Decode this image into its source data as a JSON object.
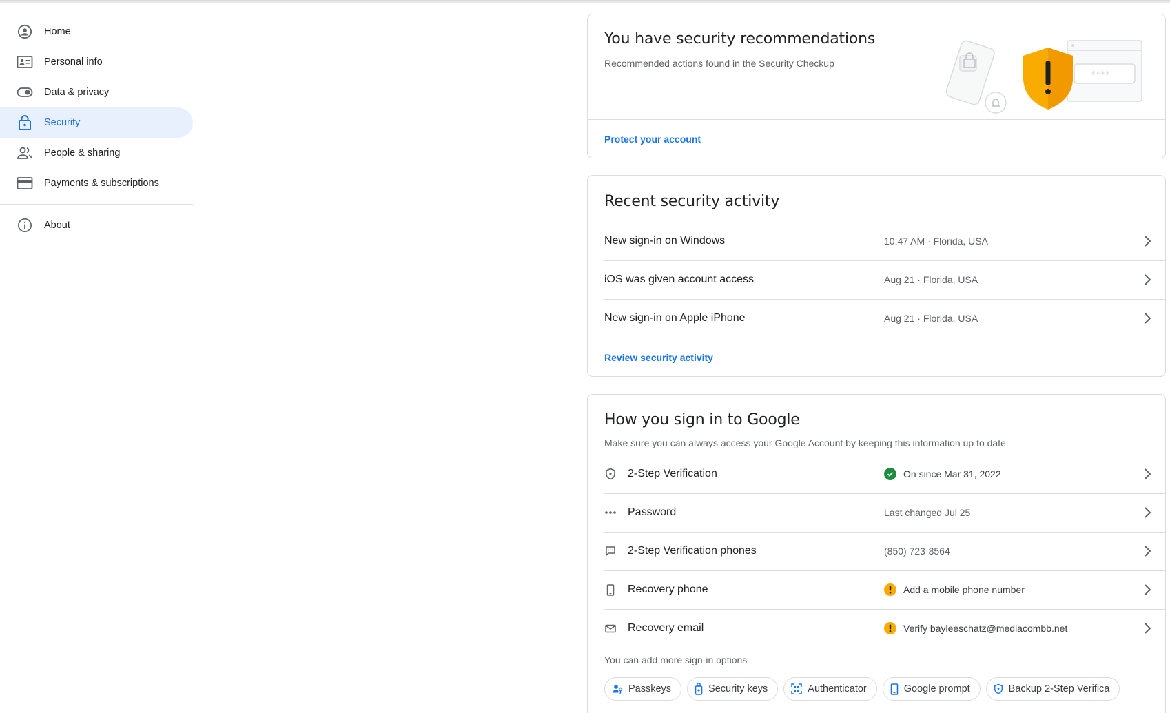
{
  "sidebar": {
    "items": [
      {
        "label": "Home",
        "icon": "account-circle-icon",
        "active": false
      },
      {
        "label": "Personal info",
        "icon": "id-card-icon",
        "active": false
      },
      {
        "label": "Data & privacy",
        "icon": "toggle-icon",
        "active": false
      },
      {
        "label": "Security",
        "icon": "lock-icon",
        "active": true
      },
      {
        "label": "People & sharing",
        "icon": "people-icon",
        "active": false
      },
      {
        "label": "Payments & subscriptions",
        "icon": "credit-card-icon",
        "active": false
      }
    ],
    "about": {
      "label": "About",
      "icon": "info-icon"
    }
  },
  "recommendations": {
    "title": "You have security recommendations",
    "subtitle": "Recommended actions found in the Security Checkup",
    "link": "Protect your account",
    "illustration_mask": "****"
  },
  "activity": {
    "title": "Recent security activity",
    "rows": [
      {
        "label": "New sign-in on Windows",
        "value": "10:47 AM · Florida, USA"
      },
      {
        "label": "iOS was given account access",
        "value": "Aug 21 · Florida, USA"
      },
      {
        "label": "New sign-in on Apple iPhone",
        "value": "Aug 21 · Florida, USA"
      }
    ],
    "link": "Review security activity"
  },
  "signin": {
    "title": "How you sign in to Google",
    "subtitle": "Make sure you can always access your Google Account by keeping this information up to date",
    "rows": [
      {
        "label": "2-Step Verification",
        "value": "On since Mar 31, 2022",
        "icon": "shield-icon",
        "status": "ok"
      },
      {
        "label": "Password",
        "value": "Last changed Jul 25",
        "icon": "password-dots-icon",
        "status": "none"
      },
      {
        "label": "2-Step Verification phones",
        "value": "(850) 723-8564",
        "icon": "message-icon",
        "status": "none"
      },
      {
        "label": "Recovery phone",
        "value": "Add a mobile phone number",
        "icon": "phone-icon",
        "status": "warn"
      },
      {
        "label": "Recovery email",
        "value": "Verify bayleeschatz@mediacombb.net",
        "icon": "mail-icon",
        "status": "warn"
      }
    ],
    "more_options": "You can add more sign-in options",
    "chips": [
      {
        "label": "Passkeys",
        "icon": "passkey-icon"
      },
      {
        "label": "Security keys",
        "icon": "security-key-icon"
      },
      {
        "label": "Authenticator",
        "icon": "qr-scan-icon"
      },
      {
        "label": "Google prompt",
        "icon": "phone-prompt-icon"
      },
      {
        "label": "Backup 2-Step Verifica",
        "icon": "shield-icon"
      }
    ]
  },
  "colors": {
    "accent": "#1a73e8",
    "active_bg": "#e8f0fe",
    "ok": "#1e8e3e",
    "warn": "#f9ab00",
    "shield": "#f9ab00"
  }
}
